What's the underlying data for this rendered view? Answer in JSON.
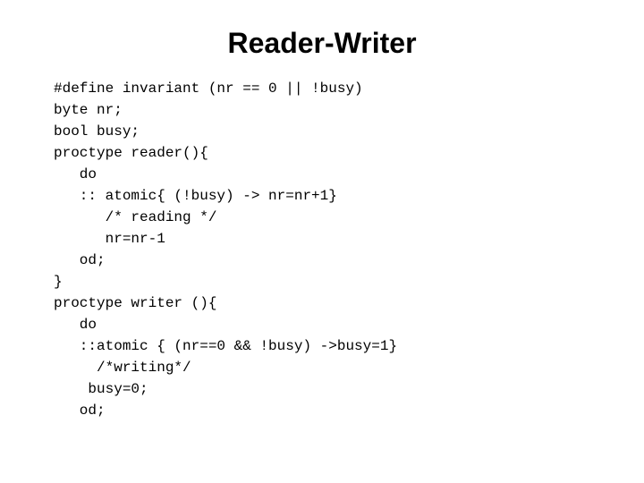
{
  "page": {
    "title": "Reader-Writer",
    "background": "#ffffff"
  },
  "content": {
    "title": "Reader-Writer",
    "code": "#define invariant (nr == 0 || !busy)\nbyte nr;\nbool busy;\nproctype reader(){\n   do\n   :: atomic{ (!busy) -> nr=nr+1}\n      /* reading */\n      nr=nr-1\n   od;\n}\nproctype writer (){\n   do\n   ::atomic { (nr==0 && !busy) ->busy=1}\n     /*writing*/\n    busy=0;\n   od;"
  }
}
